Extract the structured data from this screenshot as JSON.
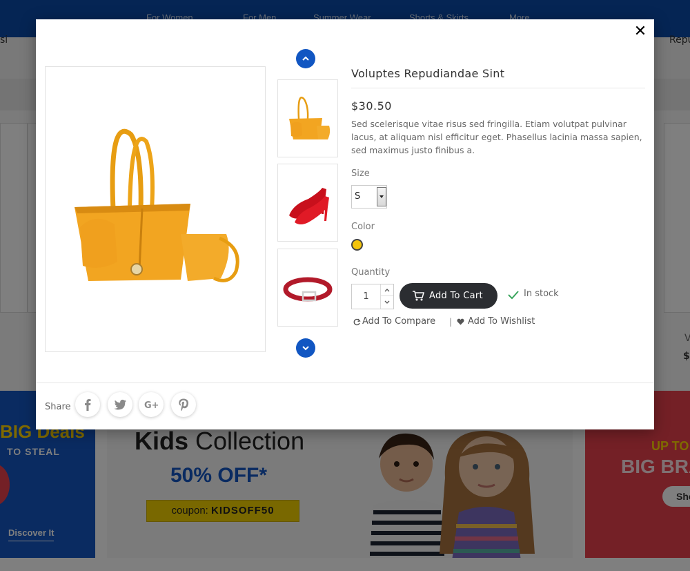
{
  "background": {
    "nav_items": [
      "For Women",
      "For Men",
      "Summer Wear",
      "Shorts & Skirts",
      "More"
    ],
    "left_edge_text": "si",
    "right_edge_text": "Repu",
    "right_price_fragment": "$",
    "right_name_fragment": "V",
    "banner_left": {
      "title": "BIG Deals",
      "subtitle": "TO STEAL",
      "link": "Discover It"
    },
    "banner_mid": {
      "title_bold": "Kids",
      "title_rest": " Collection",
      "offer": "50% OFF*",
      "coupon_prefix": "coupon: ",
      "coupon_code": "KIDSOFF50"
    },
    "banner_right": {
      "upto": "UP TO",
      "big": "BIG BRA",
      "button": "Sho"
    }
  },
  "modal": {
    "close": "✕",
    "product_name": "Voluptes Repudiandae Sint",
    "price": "$30.50",
    "description": "Sed scelerisque vitae risus sed fringilla. Etiam volutpat pulvinar lacus, at aliquam nisl efficitur eget. Phasellus lacinia massa sapien, sed maximus justo finibus a.",
    "size_label": "Size",
    "size_value": "S",
    "color_label": "Color",
    "color_swatch": "#f4c40b",
    "quantity_label": "Quantity",
    "quantity_value": "1",
    "add_to_cart": "Add To Cart",
    "stock_status": "In stock",
    "add_to_compare": "Add To Compare",
    "separator": "|",
    "add_to_wishlist": "Add To Wishlist",
    "share_label": "Share",
    "thumbnails": [
      "yellow-handbag",
      "red-heels",
      "red-belt"
    ],
    "colors": {
      "accent": "#1156c2",
      "cart_button": "#2b2d31",
      "stock_check": "#3aa55d"
    }
  }
}
